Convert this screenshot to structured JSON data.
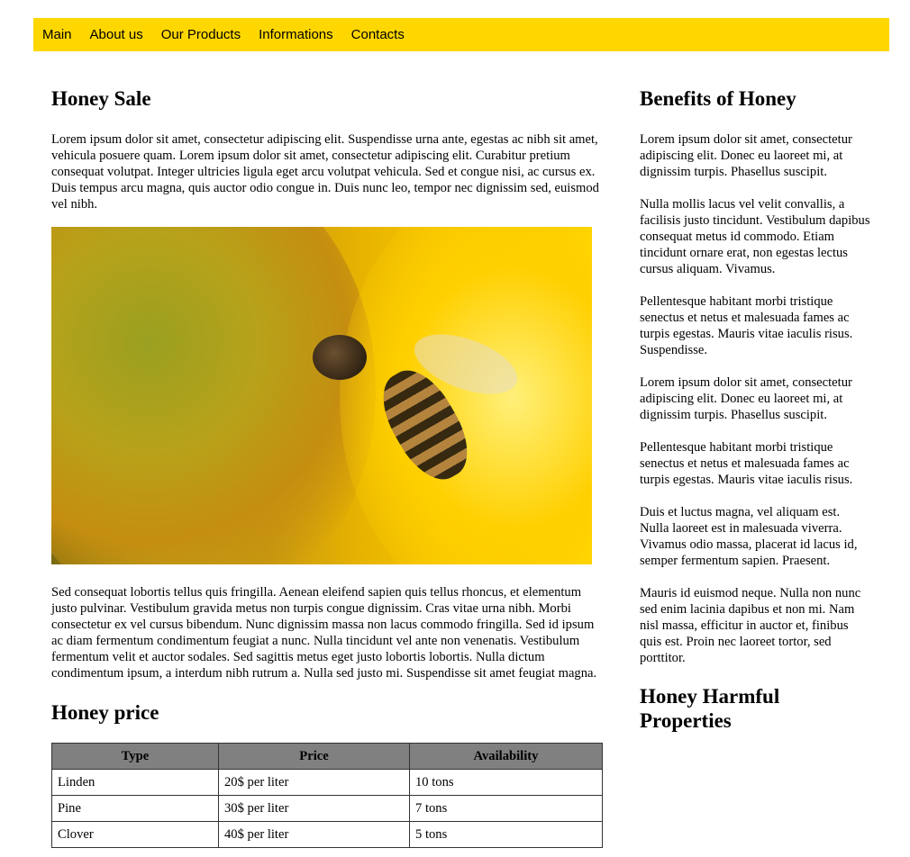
{
  "nav": {
    "items": [
      "Main",
      "About us",
      "Our Products",
      "Informations",
      "Contacts"
    ]
  },
  "main": {
    "title": "Honey Sale",
    "intro": "Lorem ipsum dolor sit amet, consectetur adipiscing elit. Suspendisse urna ante, egestas ac nibh sit amet, vehicula posuere quam. Lorem ipsum dolor sit amet, consectetur adipiscing elit. Curabitur pretium consequat volutpat. Integer ultricies ligula eget arcu volutpat vehicula. Sed et congue nisi, ac cursus ex. Duis tempus arcu magna, quis auctor odio congue in. Duis nunc leo, tempor nec dignissim sed, euismod vel nibh.",
    "after_image": "Sed consequat lobortis tellus quis fringilla. Aenean eleifend sapien quis tellus rhoncus, et elementum justo pulvinar. Vestibulum gravida metus non turpis congue dignissim. Cras vitae urna nibh. Morbi consectetur ex vel cursus bibendum. Nunc dignissim massa non lacus commodo fringilla. Sed id ipsum ac diam fermentum condimentum feugiat a nunc. Nulla tincidunt vel ante non venenatis. Vestibulum fermentum velit et auctor sodales. Sed sagittis metus eget justo lobortis lobortis. Nulla dictum condimentum ipsum, a interdum nibh rutrum a. Nulla sed justo mi. Suspendisse sit amet feugiat magna.",
    "price_title": "Honey price",
    "table": {
      "headers": [
        "Type",
        "Price",
        "Availability"
      ],
      "rows": [
        [
          "Linden",
          "20$ per liter",
          "10 tons"
        ],
        [
          "Pine",
          "30$ per liter",
          "7 tons"
        ],
        [
          "Clover",
          "40$ per liter",
          "5 tons"
        ]
      ]
    }
  },
  "side": {
    "title": "Benefits of Honey",
    "paragraphs": [
      "Lorem ipsum dolor sit amet, consectetur adipiscing elit. Donec eu laoreet mi, at dignissim turpis. Phasellus suscipit.",
      "Nulla mollis lacus vel velit convallis, a facilisis justo tincidunt. Vestibulum dapibus consequat metus id commodo. Etiam tincidunt ornare erat, non egestas lectus cursus aliquam. Vivamus.",
      "Pellentesque habitant morbi tristique senectus et netus et malesuada fames ac turpis egestas. Mauris vitae iaculis risus. Suspendisse.",
      "Lorem ipsum dolor sit amet, consectetur adipiscing elit. Donec eu laoreet mi, at dignissim turpis. Phasellus suscipit.",
      "Pellentesque habitant morbi tristique senectus et netus et malesuada fames ac turpis egestas. Mauris vitae iaculis risus.",
      "Duis et luctus magna, vel aliquam est. Nulla laoreet est in malesuada viverra. Vivamus odio massa, placerat id lacus id, semper fermentum sapien. Praesent.",
      "Mauris id euismod neque. Nulla non nunc sed enim lacinia dapibus et non mi. Nam nisl massa, efficitur in auctor et, finibus quis est. Proin nec laoreet tortor, sed porttitor."
    ],
    "harm_title": "Honey Harmful Properties"
  },
  "image": {
    "icon": "bee-on-sunflower-photo"
  }
}
